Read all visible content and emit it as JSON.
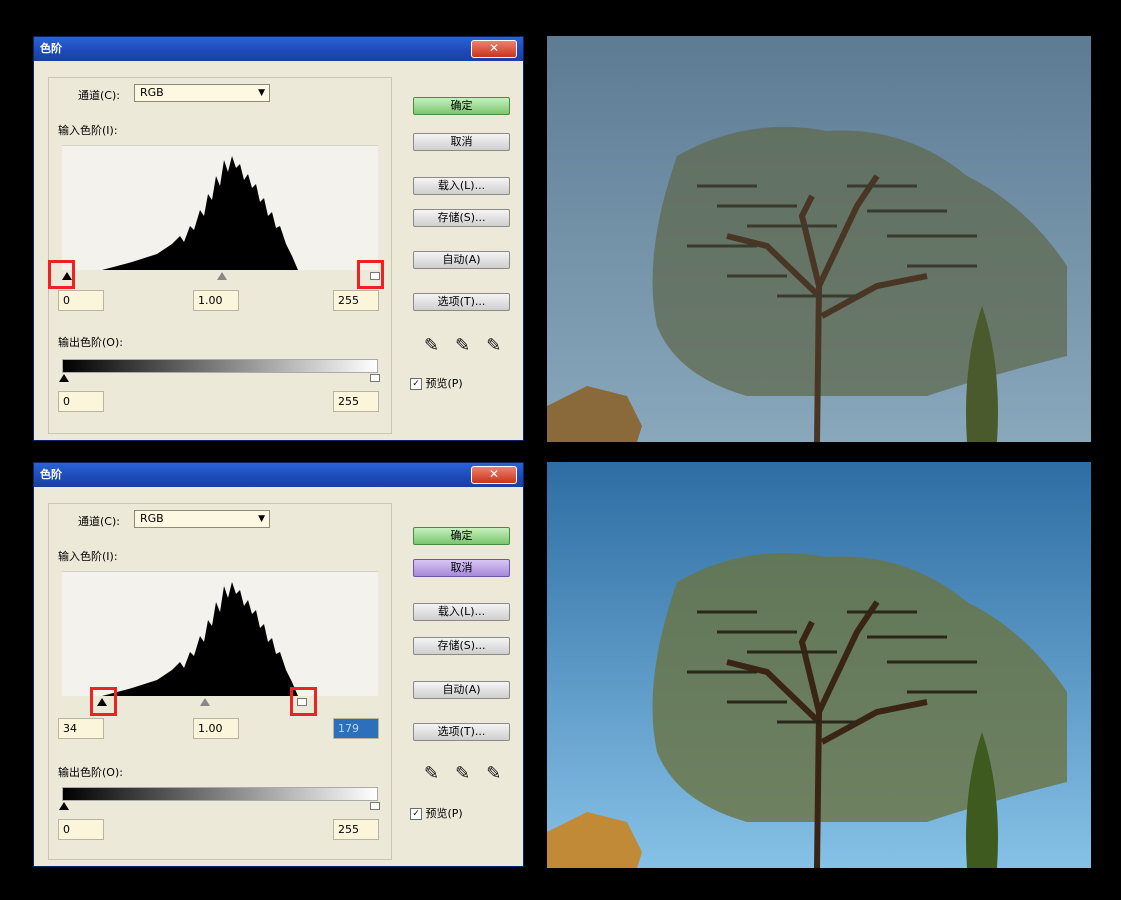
{
  "dialog_top": {
    "title": "色阶",
    "close_glyph": "✕",
    "channel_label": "通道(C):",
    "channel_value": "RGB",
    "input_levels_label": "输入色阶(I):",
    "input_black": "0",
    "input_gamma": "1.00",
    "input_white": "255",
    "output_levels_label": "输出色阶(O):",
    "output_black": "0",
    "output_white": "255",
    "buttons": {
      "ok": "确定",
      "cancel": "取消",
      "load": "载入(L)...",
      "save": "存储(S)...",
      "auto": "自动(A)",
      "options": "选项(T)..."
    },
    "preview_label": "预览(P)",
    "preview_checked": true
  },
  "dialog_bottom": {
    "title": "色阶",
    "close_glyph": "✕",
    "channel_label": "通道(C):",
    "channel_value": "RGB",
    "input_levels_label": "输入色阶(I):",
    "input_black": "34",
    "input_gamma": "1.00",
    "input_white": "179",
    "output_levels_label": "输出色阶(O):",
    "output_black": "0",
    "output_white": "255",
    "buttons": {
      "ok": "确定",
      "cancel": "取消",
      "load": "载入(L)...",
      "save": "存储(S)...",
      "auto": "自动(A)",
      "options": "选项(T)..."
    },
    "preview_label": "预览(P)",
    "preview_checked": true
  },
  "icons": [
    "close-icon",
    "dropdown-arrow-icon",
    "black-eyedropper-icon",
    "gray-eyedropper-icon",
    "white-eyedropper-icon",
    "checkbox-icon"
  ],
  "colors": {
    "titlebar": "#1d49b8",
    "dialog_bg": "#ece9d8",
    "field_bg": "#fbf5dc",
    "highlight_box": "#ee2222",
    "ok_button": "#7cc66e",
    "cancel_pressed": "#a689d8",
    "sky_before": "#6f8da3",
    "sky_after": "#3f79a8"
  }
}
